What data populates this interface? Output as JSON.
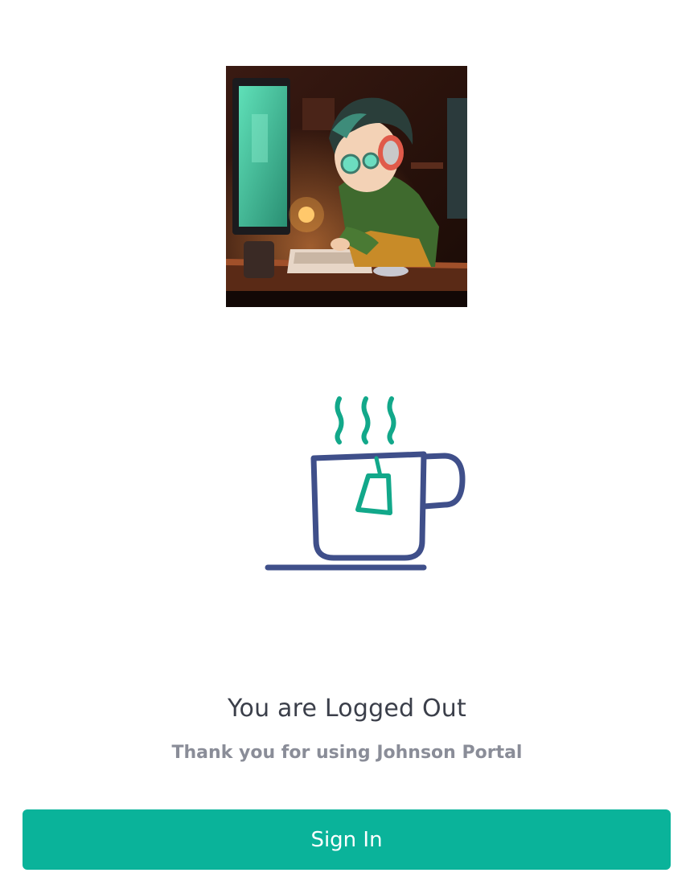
{
  "logo": {
    "icon": "avatar-image"
  },
  "illustration": {
    "icon": "coffee-cup-icon",
    "colors": {
      "steam": "#12a88a",
      "cup": "#3f4f8a",
      "tag": "#12a88a"
    }
  },
  "content": {
    "title": "You are Logged Out",
    "subtitle": "Thank you for using Johnson Portal"
  },
  "actions": {
    "signin_label": "Sign In"
  },
  "colors": {
    "accent": "#0ab39a",
    "title_text": "#3b3f4a",
    "subtitle_text": "#8a8d98"
  }
}
